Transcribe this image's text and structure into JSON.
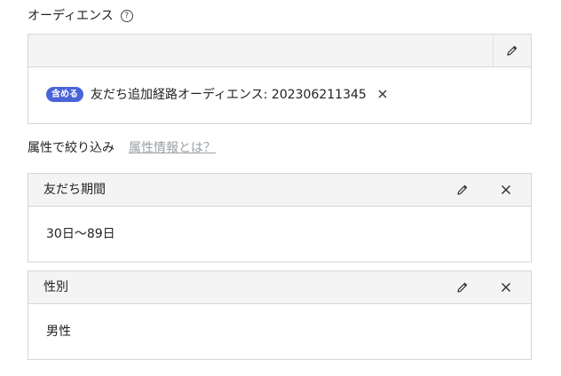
{
  "audience_section": {
    "title": "オーディエンス",
    "help_icon": "question-circle-icon",
    "include_badge": "含める",
    "audience_name": "友だち追加経路オーディエンス: 202306211345"
  },
  "attribute_filter": {
    "label": "属性で絞り込み",
    "info_link": "属性情報とは？"
  },
  "filters": [
    {
      "title": "友だち期間",
      "value": "30日〜89日"
    },
    {
      "title": "性別",
      "value": "男性"
    }
  ],
  "colors": {
    "badge": "#4a63d8",
    "link": "#9aa0a6",
    "card_header": "#f4f4f4",
    "border": "#d6d6d6"
  }
}
